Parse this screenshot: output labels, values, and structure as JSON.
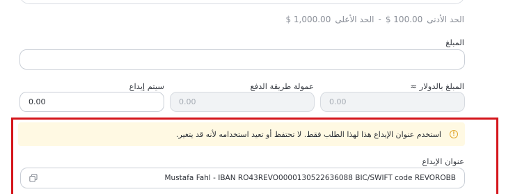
{
  "limits": {
    "min_label": "الحد الأدنى",
    "min_value": "$ 100.00",
    "separator": "-",
    "max_label": "الحد الأعلى",
    "max_value": "$ 1,000.00"
  },
  "amount": {
    "label": "المبلغ",
    "value": ""
  },
  "conversion": {
    "usd_label": "المبلغ بالدولار ≈",
    "usd_value": "0.00",
    "fee_label": "عمولة طريقة الدفع",
    "fee_value": "0.00",
    "deposit_label": "سيتم إيداع",
    "deposit_value": "0.00"
  },
  "warning": {
    "icon": "info-circle-icon",
    "text": "استخدم عنوان الإيداع هذا لهذا الطلب فقط. لا تحتفظ أو تعيد استخدامه لأنه قد يتغير.",
    "accent_color": "#e0a52a",
    "background_color": "#fff9e3"
  },
  "deposit_address": {
    "label": "عنوان الإيداع",
    "value": "Mustafa Fahl - IBAN RO43REVO0000130522636088 BIC/SWIFT code REVOROBB",
    "copy_icon": "copy-icon"
  },
  "highlight_color": "#d4151b"
}
